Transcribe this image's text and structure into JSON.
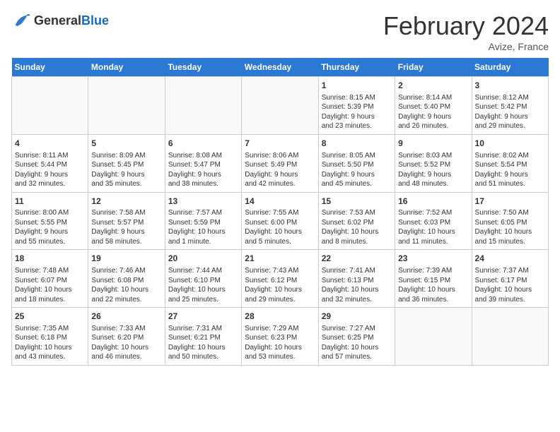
{
  "header": {
    "logo_general": "General",
    "logo_blue": "Blue",
    "month_year": "February 2024",
    "location": "Avize, France"
  },
  "calendar": {
    "days_of_week": [
      "Sunday",
      "Monday",
      "Tuesday",
      "Wednesday",
      "Thursday",
      "Friday",
      "Saturday"
    ],
    "weeks": [
      [
        {
          "day": "",
          "info": ""
        },
        {
          "day": "",
          "info": ""
        },
        {
          "day": "",
          "info": ""
        },
        {
          "day": "",
          "info": ""
        },
        {
          "day": "1",
          "info": "Sunrise: 8:15 AM\nSunset: 5:39 PM\nDaylight: 9 hours\nand 23 minutes."
        },
        {
          "day": "2",
          "info": "Sunrise: 8:14 AM\nSunset: 5:40 PM\nDaylight: 9 hours\nand 26 minutes."
        },
        {
          "day": "3",
          "info": "Sunrise: 8:12 AM\nSunset: 5:42 PM\nDaylight: 9 hours\nand 29 minutes."
        }
      ],
      [
        {
          "day": "4",
          "info": "Sunrise: 8:11 AM\nSunset: 5:44 PM\nDaylight: 9 hours\nand 32 minutes."
        },
        {
          "day": "5",
          "info": "Sunrise: 8:09 AM\nSunset: 5:45 PM\nDaylight: 9 hours\nand 35 minutes."
        },
        {
          "day": "6",
          "info": "Sunrise: 8:08 AM\nSunset: 5:47 PM\nDaylight: 9 hours\nand 38 minutes."
        },
        {
          "day": "7",
          "info": "Sunrise: 8:06 AM\nSunset: 5:49 PM\nDaylight: 9 hours\nand 42 minutes."
        },
        {
          "day": "8",
          "info": "Sunrise: 8:05 AM\nSunset: 5:50 PM\nDaylight: 9 hours\nand 45 minutes."
        },
        {
          "day": "9",
          "info": "Sunrise: 8:03 AM\nSunset: 5:52 PM\nDaylight: 9 hours\nand 48 minutes."
        },
        {
          "day": "10",
          "info": "Sunrise: 8:02 AM\nSunset: 5:54 PM\nDaylight: 9 hours\nand 51 minutes."
        }
      ],
      [
        {
          "day": "11",
          "info": "Sunrise: 8:00 AM\nSunset: 5:55 PM\nDaylight: 9 hours\nand 55 minutes."
        },
        {
          "day": "12",
          "info": "Sunrise: 7:58 AM\nSunset: 5:57 PM\nDaylight: 9 hours\nand 58 minutes."
        },
        {
          "day": "13",
          "info": "Sunrise: 7:57 AM\nSunset: 5:59 PM\nDaylight: 10 hours\nand 1 minute."
        },
        {
          "day": "14",
          "info": "Sunrise: 7:55 AM\nSunset: 6:00 PM\nDaylight: 10 hours\nand 5 minutes."
        },
        {
          "day": "15",
          "info": "Sunrise: 7:53 AM\nSunset: 6:02 PM\nDaylight: 10 hours\nand 8 minutes."
        },
        {
          "day": "16",
          "info": "Sunrise: 7:52 AM\nSunset: 6:03 PM\nDaylight: 10 hours\nand 11 minutes."
        },
        {
          "day": "17",
          "info": "Sunrise: 7:50 AM\nSunset: 6:05 PM\nDaylight: 10 hours\nand 15 minutes."
        }
      ],
      [
        {
          "day": "18",
          "info": "Sunrise: 7:48 AM\nSunset: 6:07 PM\nDaylight: 10 hours\nand 18 minutes."
        },
        {
          "day": "19",
          "info": "Sunrise: 7:46 AM\nSunset: 6:08 PM\nDaylight: 10 hours\nand 22 minutes."
        },
        {
          "day": "20",
          "info": "Sunrise: 7:44 AM\nSunset: 6:10 PM\nDaylight: 10 hours\nand 25 minutes."
        },
        {
          "day": "21",
          "info": "Sunrise: 7:43 AM\nSunset: 6:12 PM\nDaylight: 10 hours\nand 29 minutes."
        },
        {
          "day": "22",
          "info": "Sunrise: 7:41 AM\nSunset: 6:13 PM\nDaylight: 10 hours\nand 32 minutes."
        },
        {
          "day": "23",
          "info": "Sunrise: 7:39 AM\nSunset: 6:15 PM\nDaylight: 10 hours\nand 36 minutes."
        },
        {
          "day": "24",
          "info": "Sunrise: 7:37 AM\nSunset: 6:17 PM\nDaylight: 10 hours\nand 39 minutes."
        }
      ],
      [
        {
          "day": "25",
          "info": "Sunrise: 7:35 AM\nSunset: 6:18 PM\nDaylight: 10 hours\nand 43 minutes."
        },
        {
          "day": "26",
          "info": "Sunrise: 7:33 AM\nSunset: 6:20 PM\nDaylight: 10 hours\nand 46 minutes."
        },
        {
          "day": "27",
          "info": "Sunrise: 7:31 AM\nSunset: 6:21 PM\nDaylight: 10 hours\nand 50 minutes."
        },
        {
          "day": "28",
          "info": "Sunrise: 7:29 AM\nSunset: 6:23 PM\nDaylight: 10 hours\nand 53 minutes."
        },
        {
          "day": "29",
          "info": "Sunrise: 7:27 AM\nSunset: 6:25 PM\nDaylight: 10 hours\nand 57 minutes."
        },
        {
          "day": "",
          "info": ""
        },
        {
          "day": "",
          "info": ""
        }
      ]
    ]
  }
}
